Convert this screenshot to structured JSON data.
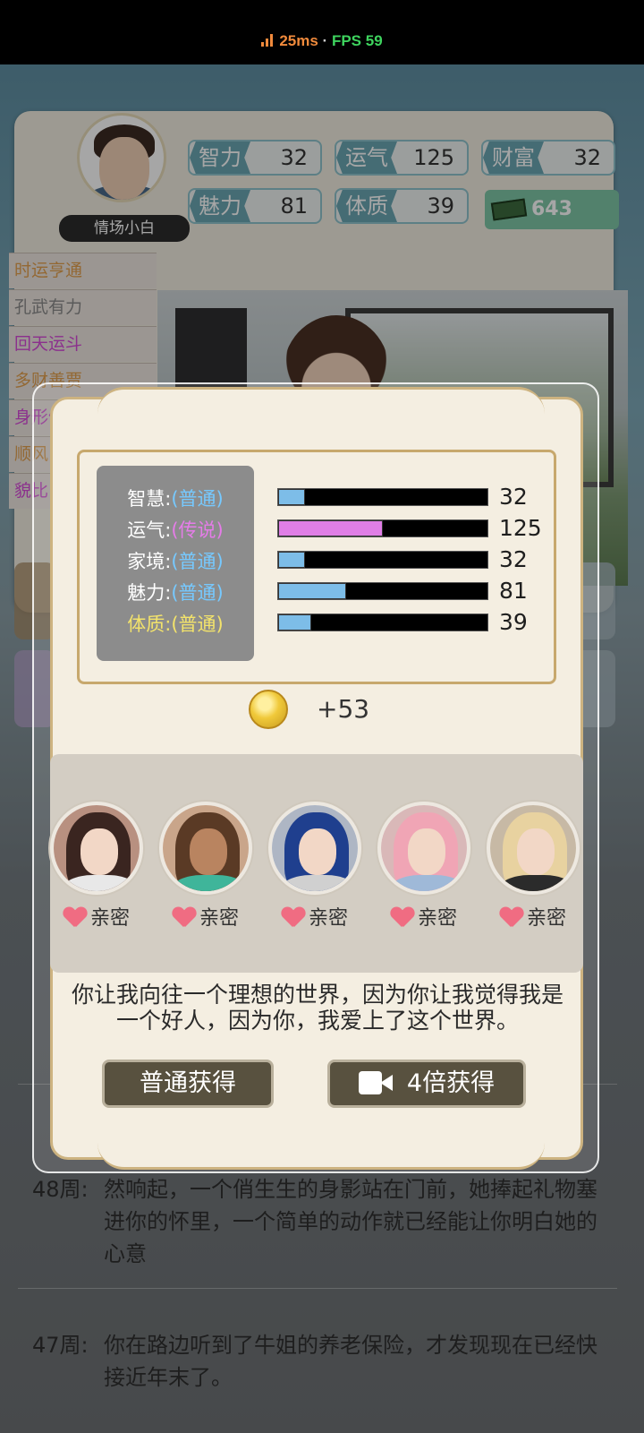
{
  "network": {
    "ping": "25ms",
    "separator": "·",
    "fps": "FPS 59"
  },
  "player": {
    "name": "情场小白",
    "money": "643"
  },
  "header_stats": [
    {
      "label": "智力",
      "value": "32"
    },
    {
      "label": "运气",
      "value": "125"
    },
    {
      "label": "财富",
      "value": "32"
    },
    {
      "label": "魅力",
      "value": "81"
    },
    {
      "label": "体质",
      "value": "39"
    }
  ],
  "traits": [
    {
      "label": "时运亨通",
      "color": "#e2a04f"
    },
    {
      "label": "孔武有力",
      "color": "#8a8a8a"
    },
    {
      "label": "回天运斗",
      "color": "#d64ad9"
    },
    {
      "label": "多财善贾",
      "color": "#e2a04f"
    },
    {
      "label": "身形健美",
      "color": "#d64ad9"
    },
    {
      "label": "顺风",
      "color": "#e2a04f"
    },
    {
      "label": "貌比",
      "color": "#d64ad9"
    }
  ],
  "feed": [
    {
      "week": "48周:",
      "text": "然响起，一个俏生生的身影站在门前，她捧起礼物塞进你的怀里，一个简单的动作就已经能让你明白她的心意"
    },
    {
      "week": "47周:",
      "text": "你在路边听到了牛姐的养老保险，才发现现在已经快接近年末了。"
    }
  ],
  "result": {
    "stats": [
      {
        "name": "智慧:",
        "grade": "(普通)",
        "value": "32",
        "fill": 0.128,
        "color": "#7dbde8"
      },
      {
        "name": "运气:",
        "grade": "(传说)",
        "value": "125",
        "fill": 0.5,
        "color": "#e07ee6"
      },
      {
        "name": "家境:",
        "grade": "(普通)",
        "value": "32",
        "fill": 0.128,
        "color": "#7dbde8"
      },
      {
        "name": "魅力:",
        "grade": "(普通)",
        "value": "81",
        "fill": 0.324,
        "color": "#7dbde8"
      },
      {
        "name": "体质:",
        "grade": "(普通)",
        "value": "39",
        "fill": 0.156,
        "color": "#7dbde8"
      }
    ],
    "coin_gain": "+53",
    "girls": [
      {
        "tag": "亲密",
        "hair": "#3a2520",
        "body": "#e8e8e8",
        "bg": "#b89080"
      },
      {
        "tag": "亲密",
        "hair": "#5a3a25",
        "body": "#3fb59a",
        "bg": "#c9a58a"
      },
      {
        "tag": "亲密",
        "hair": "#1f3f8e",
        "body": "#d0d0d0",
        "bg": "#aeb6c4"
      },
      {
        "tag": "亲密",
        "hair": "#f0a5b5",
        "body": "#9fb9d8",
        "bg": "#d9b8b8"
      },
      {
        "tag": "亲密",
        "hair": "#e8d2a0",
        "body": "#2b2b2b",
        "bg": "#c7b9a5"
      }
    ],
    "story": "你让我向往一个理想的世界，因为你让我觉得我是一个好人，因为你，我爱上了这个世界。",
    "normal_button": "普通获得",
    "video_button": "4倍获得"
  }
}
